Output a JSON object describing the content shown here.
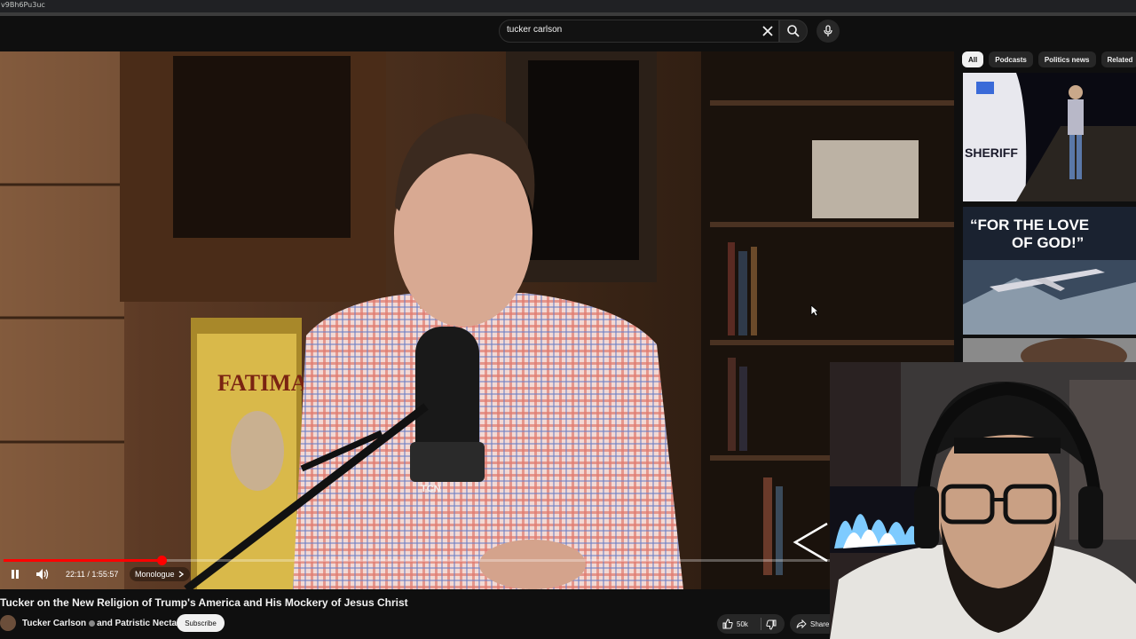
{
  "browser": {
    "url_fragment": "v9Bh6Pu3uc"
  },
  "search": {
    "query": "tucker carlson"
  },
  "player": {
    "time_display": "22:11 / 1:55:57",
    "chapter": "Monologue",
    "progress": 0.191,
    "poster_text": "FATIMA",
    "mic_logo": "TCN"
  },
  "video": {
    "title": "Tucker on the New Religion of Trump's America and His Mockery of Jesus Christ",
    "channel": "Tucker Carlson",
    "channel_suffix": "and Patristic Nectar",
    "subscribe_label": "Subscribe",
    "likes": "50k",
    "share_label": "Share"
  },
  "sidebar": {
    "chips": [
      "All",
      "Podcasts",
      "Politics news",
      "Related"
    ],
    "active_chip": "All",
    "thumb1_text": "SHERIFF",
    "thumb2_line1": "“FOR THE LOVE",
    "thumb2_line2": "OF GOD!”"
  },
  "colors": {
    "accent": "#ff0000",
    "background": "#0f0f0f",
    "chip": "#272727"
  }
}
